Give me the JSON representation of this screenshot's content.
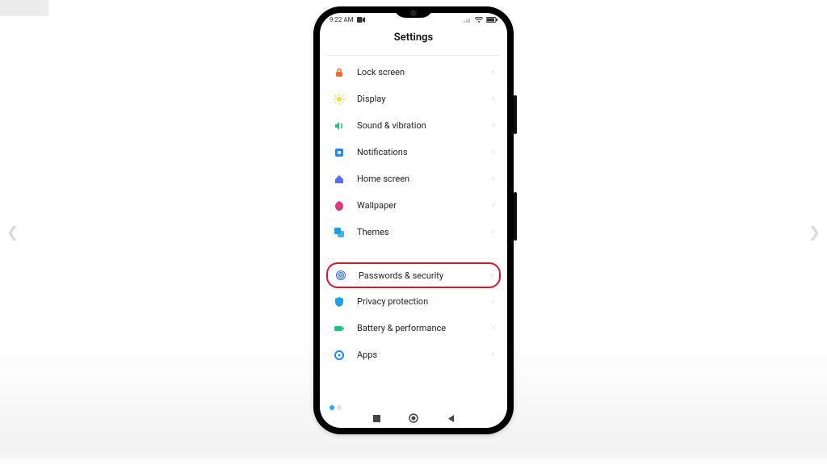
{
  "status": {
    "time": "9:22 AM"
  },
  "header": {
    "title": "Settings"
  },
  "settings": {
    "group1": [
      {
        "id": "lock-screen",
        "label": "Lock screen",
        "icon": "lock-icon",
        "color": "#f96a2b"
      },
      {
        "id": "display",
        "label": "Display",
        "icon": "sun-icon",
        "color": "#fdd835"
      },
      {
        "id": "sound",
        "label": "Sound & vibration",
        "icon": "sound-icon",
        "color": "#1bc47d"
      },
      {
        "id": "notifications",
        "label": "Notifications",
        "icon": "bell-icon",
        "color": "#1e88ff"
      },
      {
        "id": "home",
        "label": "Home screen",
        "icon": "home-icon",
        "color": "#5b6bff"
      },
      {
        "id": "wallpaper",
        "label": "Wallpaper",
        "icon": "wallpaper-icon",
        "color": "#e0367a"
      },
      {
        "id": "themes",
        "label": "Themes",
        "icon": "themes-icon",
        "color": "#1aa0e6"
      }
    ],
    "group2": [
      {
        "id": "passwords",
        "label": "Passwords & security",
        "icon": "fingerprint-icon",
        "color": "#2a6bff",
        "highlight": true
      },
      {
        "id": "privacy",
        "label": "Privacy protection",
        "icon": "shield-icon",
        "color": "#1aa0e6"
      },
      {
        "id": "battery",
        "label": "Battery & performance",
        "icon": "battery-icon",
        "color": "#1bc47d"
      },
      {
        "id": "apps",
        "label": "Apps",
        "icon": "apps-icon",
        "color": "#1e88ff"
      }
    ]
  }
}
